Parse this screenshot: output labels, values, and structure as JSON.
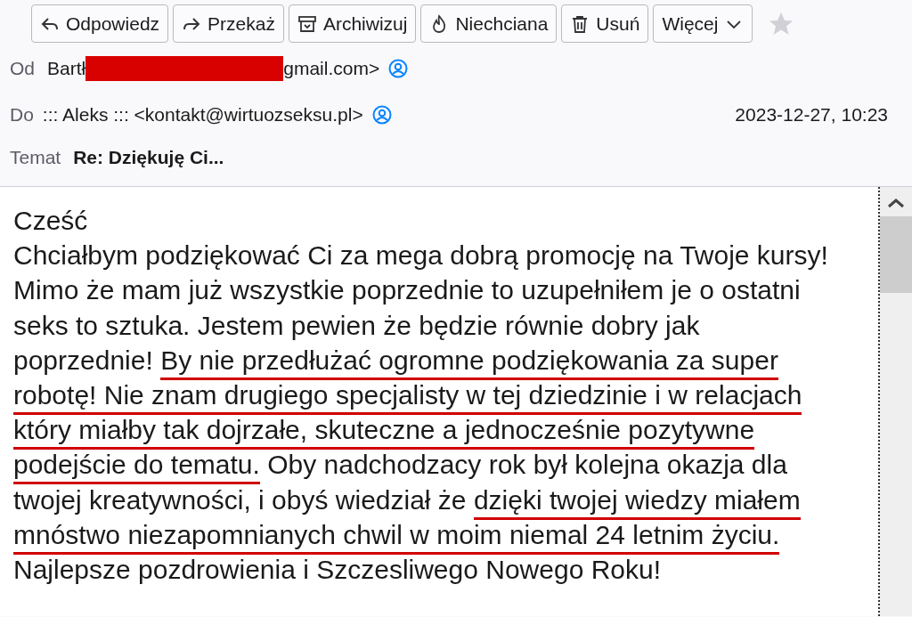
{
  "toolbar": [
    {
      "label": "Odpowiedz"
    },
    {
      "label": "Przekaż"
    },
    {
      "label": "Archiwizuj"
    },
    {
      "label": "Niechciana"
    },
    {
      "label": "Usuń"
    },
    {
      "label": "Więcej"
    }
  ],
  "starred": false,
  "header": {
    "from_label": "Od",
    "from_start": "Bartł",
    "from_redacted": true,
    "from_end": "gmail.com>",
    "to_label": "Do",
    "to": "::: Aleks ::: <kontakt@wirtuozseksu.pl>",
    "date": "2023-12-27, 10:23",
    "subject_label": "Temat",
    "subject": "Re: Dziękuję Ci..."
  },
  "body": [
    [
      {
        "text": "Cześć",
        "underlined": false
      }
    ],
    [
      {
        "text": "Chciałbym podziękować Ci za mega dobrą promocję na Twoje kursy!",
        "underlined": false
      }
    ],
    [
      {
        "text": "Mimo że mam już wszystkie poprzednie to uzupełniłem je o ostatni",
        "underlined": false
      }
    ],
    [
      {
        "text": "seks to sztuka. Jestem pewien że będzie równie dobry jak",
        "underlined": false
      }
    ],
    [
      {
        "text": "poprzednie!",
        "underlined": false
      },
      {
        "text": "By nie przedłużać ogromne podziękowania za super",
        "underlined": true
      }
    ],
    [
      {
        "text": "robotę! Nie znam drugiego specjalisty w tej dziedzinie i w relacjach",
        "underlined": true
      }
    ],
    [
      {
        "text": "który miałby tak dojrzałe, skuteczne a jednocześnie pozytywne",
        "underlined": true
      }
    ],
    [
      {
        "text": "podejście do tematu.",
        "underlined": true
      },
      {
        "text": "Oby nadchodzacy rok był kolejna okazja dla",
        "underlined": false
      }
    ],
    [
      {
        "text": "twojej kreatywności, i obyś wiedział że",
        "underlined": false
      },
      {
        "text": "dzięki twojej wiedzy miałem",
        "underlined": true
      }
    ],
    [
      {
        "text": "mnóstwo niezapomnianych chwil w moim niemal 24 letnim życiu.",
        "underlined": true
      }
    ],
    [
      {
        "text": "Najlepsze pozdrowienia i Szczesliwego Nowego Roku!",
        "underlined": false
      }
    ]
  ]
}
